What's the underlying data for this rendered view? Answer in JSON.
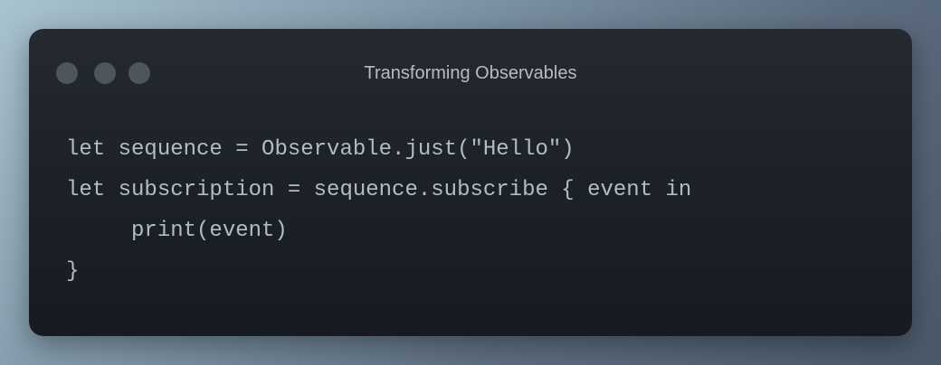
{
  "window": {
    "title": "Transforming Observables",
    "controls": [
      "close-dot",
      "minimize-dot",
      "maximize-dot"
    ]
  },
  "code": {
    "language": "swift",
    "lines": [
      "let sequence = Observable.just(\"Hello\")",
      "let subscription = sequence.subscribe { event in",
      "print(event)",
      "}"
    ]
  },
  "colors": {
    "background_gradient": [
      "#a9c3cf",
      "#4a586a"
    ],
    "window_background": "#1d2229",
    "control_dot": "#4f555d",
    "title_text": "#b7bcc3",
    "code_text": "#b3bcc5"
  }
}
